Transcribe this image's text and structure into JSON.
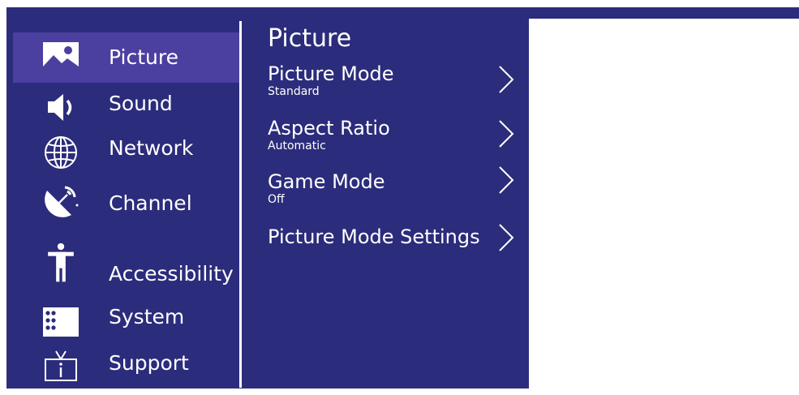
{
  "sidebar": {
    "items": [
      {
        "label": "Picture",
        "icon": "picture-icon",
        "active": true
      },
      {
        "label": "Sound",
        "icon": "speaker-icon",
        "active": false
      },
      {
        "label": "Network",
        "icon": "globe-icon",
        "active": false
      },
      {
        "label": "Channel",
        "icon": "satellite-dish-icon",
        "active": false
      },
      {
        "label": "Accessibility",
        "icon": "accessibility-person-icon",
        "active": false
      },
      {
        "label": "System",
        "icon": "system-grid-icon",
        "active": false
      },
      {
        "label": "Support",
        "icon": "tv-info-icon",
        "active": false
      }
    ]
  },
  "panel": {
    "title": "Picture",
    "items": [
      {
        "label": "Picture Mode",
        "value": "Standard"
      },
      {
        "label": "Aspect Ratio",
        "value": "Automatic"
      },
      {
        "label": "Game Mode",
        "value": "Off"
      },
      {
        "label": "Picture Mode Settings",
        "value": ""
      }
    ]
  },
  "colors": {
    "background": "#2c2c7c",
    "active_item": "#4b3fa0",
    "text": "#ffffff"
  }
}
